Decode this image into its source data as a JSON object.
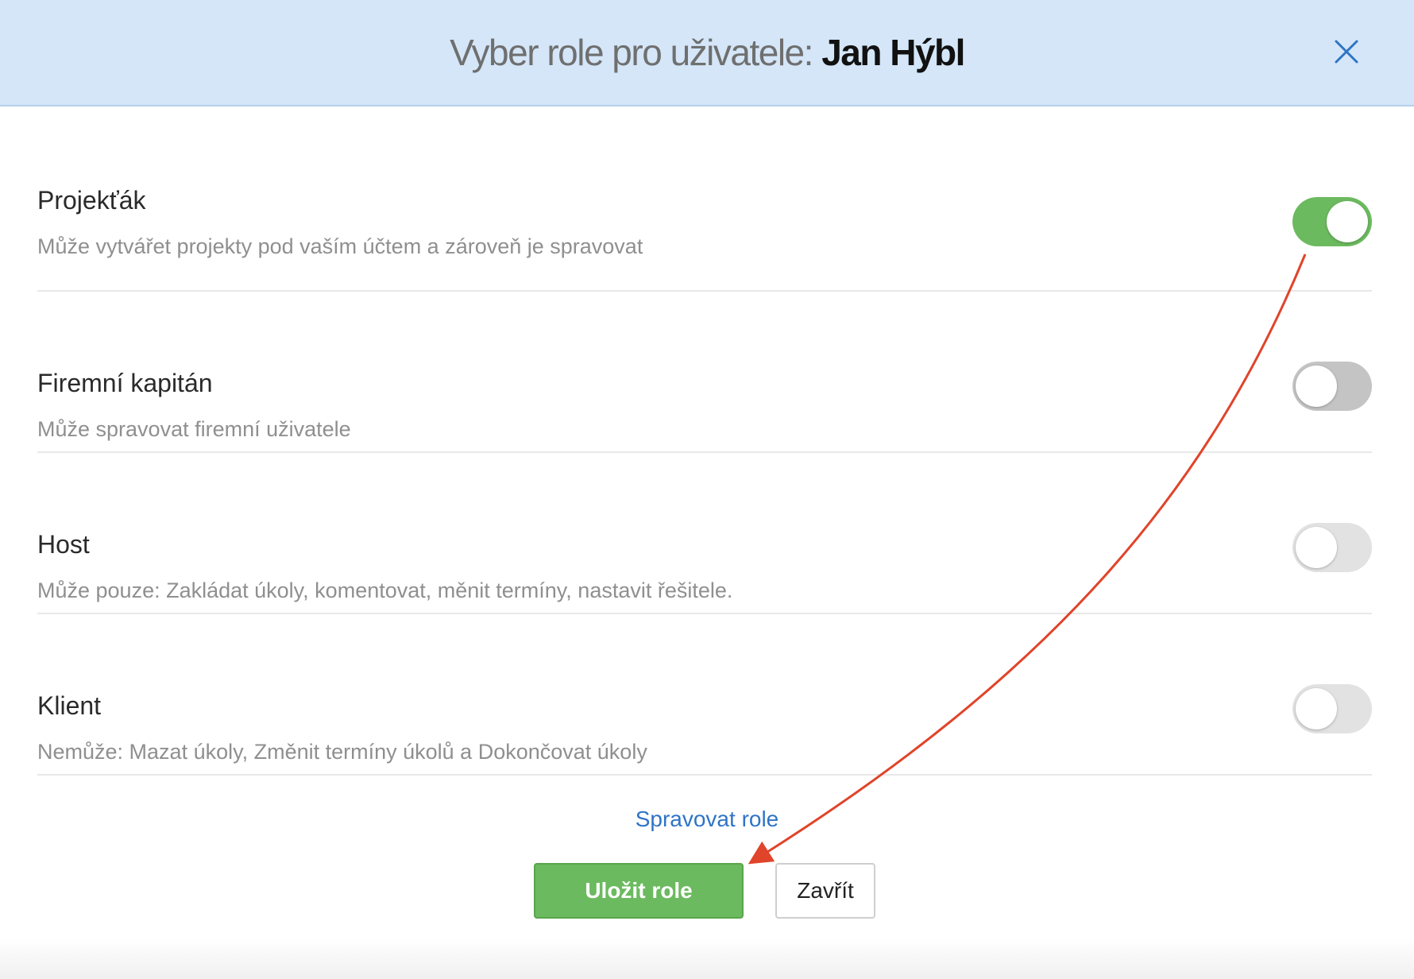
{
  "dialog": {
    "title_prefix": "Vyber role pro uživatele:",
    "user_name": "Jan Hýbl"
  },
  "roles": [
    {
      "name": "Projekťák",
      "description": "Může vytvářet projekty pod vaším účtem a zároveň je spravovat",
      "enabled": true
    },
    {
      "name": "Firemní kapitán",
      "description": "Může spravovat firemní uživatele",
      "enabled": false
    },
    {
      "name": "Host",
      "description": "Může pouze: Zakládat úkoly, komentovat, měnit termíny, nastavit řešitele.",
      "enabled": false
    },
    {
      "name": "Klient",
      "description": "Nemůže: Mazat úkoly, Změnit termíny úkolů a Dokončovat úkoly",
      "enabled": false
    }
  ],
  "manage_roles_link": "Spravovat role",
  "buttons": {
    "save_label": "Uložit role",
    "close_label": "Zavřít"
  },
  "colors": {
    "header_bg": "#d4e6f8",
    "toggle_on": "#6cba5f",
    "save_button": "#6cba5f",
    "link": "#2f74c6",
    "annotation_arrow": "#e0442a"
  },
  "icons": {
    "close": "close-icon"
  }
}
